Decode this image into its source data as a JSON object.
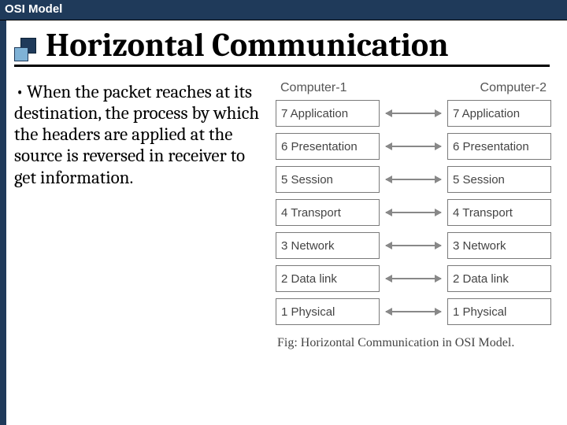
{
  "header": {
    "title": "OSI Model"
  },
  "page": {
    "title": "Horizontal Communication",
    "bullet_text": "When the packet reaches at its destination, the process by which the headers are applied at the source is reversed in receiver to get information."
  },
  "diagram": {
    "left_header": "Computer-1",
    "right_header": "Computer-2",
    "layers": [
      "7 Application",
      "6 Presentation",
      "5 Session",
      "4 Transport",
      "3 Network",
      "2 Data link",
      "1 Physical"
    ],
    "caption": "Fig: Horizontal Communication in OSI Model."
  }
}
